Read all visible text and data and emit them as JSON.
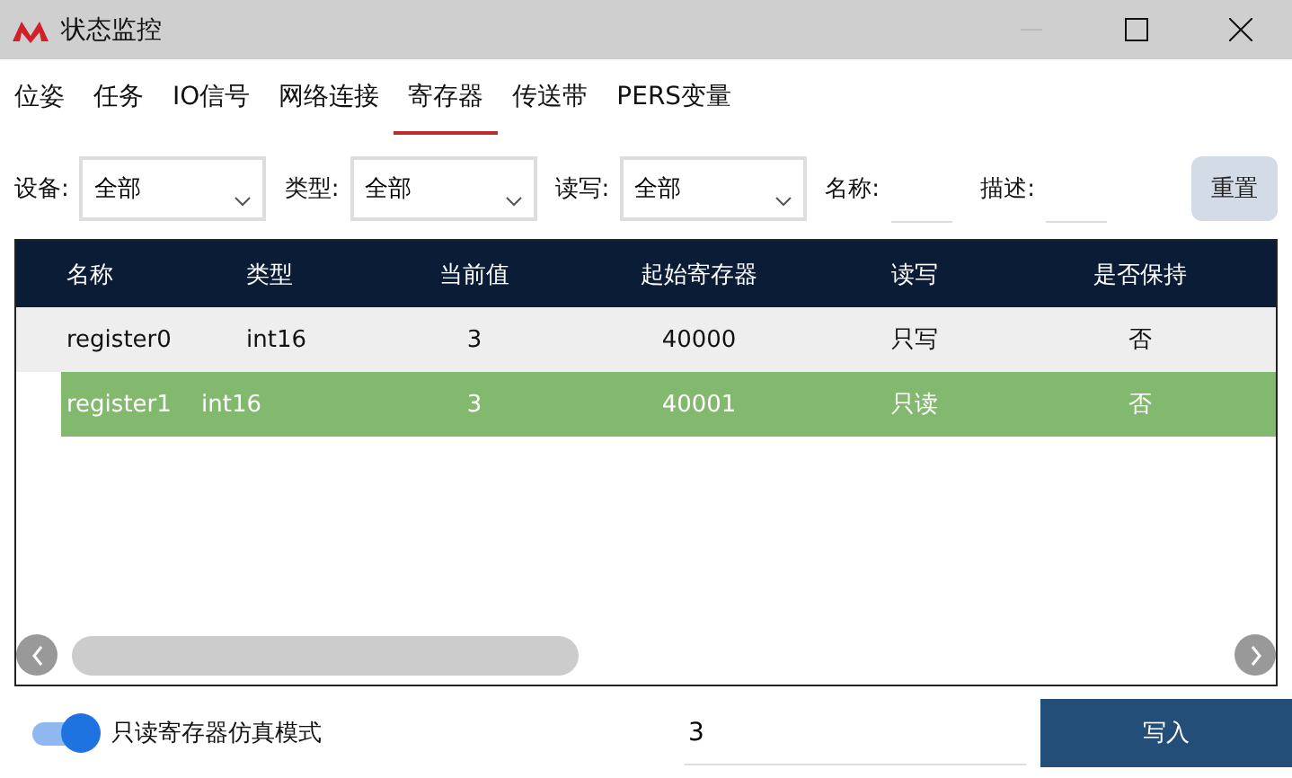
{
  "window": {
    "title": "状态监控"
  },
  "tabs": [
    {
      "label": "位姿",
      "selected": false
    },
    {
      "label": "任务",
      "selected": false
    },
    {
      "label": "IO信号",
      "selected": false
    },
    {
      "label": "网络连接",
      "selected": false
    },
    {
      "label": "寄存器",
      "selected": true
    },
    {
      "label": "传送带",
      "selected": false
    },
    {
      "label": "PERS变量",
      "selected": false
    }
  ],
  "filters": [
    {
      "kind": "select",
      "label": "设备:",
      "value": "全部"
    },
    {
      "kind": "select",
      "label": "类型:",
      "value": "全部"
    },
    {
      "kind": "select",
      "label": "读写:",
      "value": "全部"
    },
    {
      "kind": "text",
      "label": "名称:"
    },
    {
      "kind": "text",
      "label": "描述:"
    }
  ],
  "reset_button": "重置",
  "table": {
    "columns": [
      "名称",
      "类型",
      "当前值",
      "起始寄存器",
      "读写",
      "是否保持"
    ],
    "rows": [
      {
        "cells": [
          "register0",
          "int16",
          "3",
          "40000",
          "只写",
          "否"
        ],
        "selected": false
      },
      {
        "cells": [
          "register1",
          "int16",
          "3",
          "40001",
          "只读",
          "否"
        ],
        "selected": true
      }
    ]
  },
  "simulation_toggle": {
    "label": "只读寄存器仿真模式",
    "on": true
  },
  "write_value": "3",
  "write_button": "写入"
}
